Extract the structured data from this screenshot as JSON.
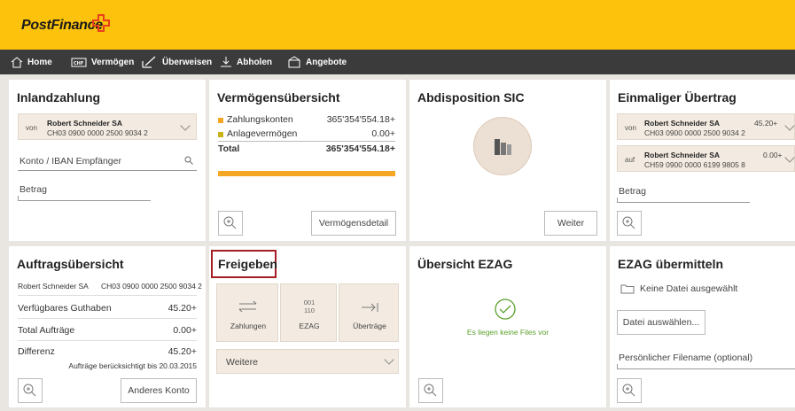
{
  "brand": {
    "name": "PostFinance",
    "accent": "#fcc20c",
    "cross_color": "#e8401c"
  },
  "nav": [
    {
      "label": "Home",
      "icon": "home-icon"
    },
    {
      "label": "Vermögen",
      "icon": "chf-icon"
    },
    {
      "label": "Überweisen",
      "icon": "pen-icon"
    },
    {
      "label": "Abholen",
      "icon": "download-icon"
    },
    {
      "label": "Angebote",
      "icon": "offer-icon"
    }
  ],
  "inland": {
    "title": "Inlandzahlung",
    "von_label": "von",
    "account_name": "Robert Schneider SA",
    "account_iban": "CH03 0900 0000 2500 9034 2",
    "konto_placeholder": "Konto / IBAN Empfänger",
    "betrag_placeholder": "Betrag"
  },
  "vermoegen": {
    "title": "Vermögensübersicht",
    "rows": [
      {
        "label": "Zahlungskonten",
        "value": "365'354'554.18+",
        "color": "#f5a623"
      },
      {
        "label": "Anlagevermögen",
        "value": "0.00+",
        "color": "#c9b21a"
      }
    ],
    "total_label": "Total",
    "total_value": "365'354'554.18+",
    "bar_fill": 1.0,
    "detail_button": "Vermögensdetail"
  },
  "abdisposition": {
    "title": "Abdisposition SIC",
    "button": "Weiter"
  },
  "einmalig": {
    "title": "Einmaliger Übertrag",
    "von": {
      "label": "von",
      "name": "Robert Schneider SA",
      "iban": "CH03 0900 0000 2500 9034 2",
      "amount": "45.20+"
    },
    "auf": {
      "label": "auf",
      "name": "Robert Schneider SA",
      "iban": "CH59 0900 0000 6199 9805 8",
      "amount": "0.00+"
    },
    "betrag_placeholder": "Betrag"
  },
  "auftrag": {
    "title": "Auftragsübersicht",
    "account_name": "Robert Schneider SA",
    "account_iban": "CH03 0900 0000 2500 9034 2",
    "rows": [
      {
        "label": "Verfügbares Guthaben",
        "value": "45.20+"
      },
      {
        "label": "Total Aufträge",
        "value": "0.00+"
      },
      {
        "label": "Differenz",
        "value": "45.20+"
      }
    ],
    "note": "Aufträge berücksichtigt bis 20.03.2015",
    "other_button": "Anderes Konto"
  },
  "freigeben": {
    "title": "Freigeben",
    "highlight": "#a31f24",
    "options": [
      {
        "label": "Zahlungen",
        "icon": "arrows-icon"
      },
      {
        "label": "EZAG",
        "icon_text": "001\n110"
      },
      {
        "label": "Überträge",
        "icon": "arrow-right-bar-icon"
      }
    ],
    "more": "Weitere"
  },
  "ezag": {
    "title": "Übersicht EZAG",
    "status": "Es liegen keine Files vor",
    "status_color": "#5aa02c"
  },
  "ezag_send": {
    "title": "EZAG übermitteln",
    "no_file": "Keine Datei ausgewählt",
    "choose_button": "Datei auswählen...",
    "filename_placeholder": "Persönlicher Filename (optional)"
  }
}
